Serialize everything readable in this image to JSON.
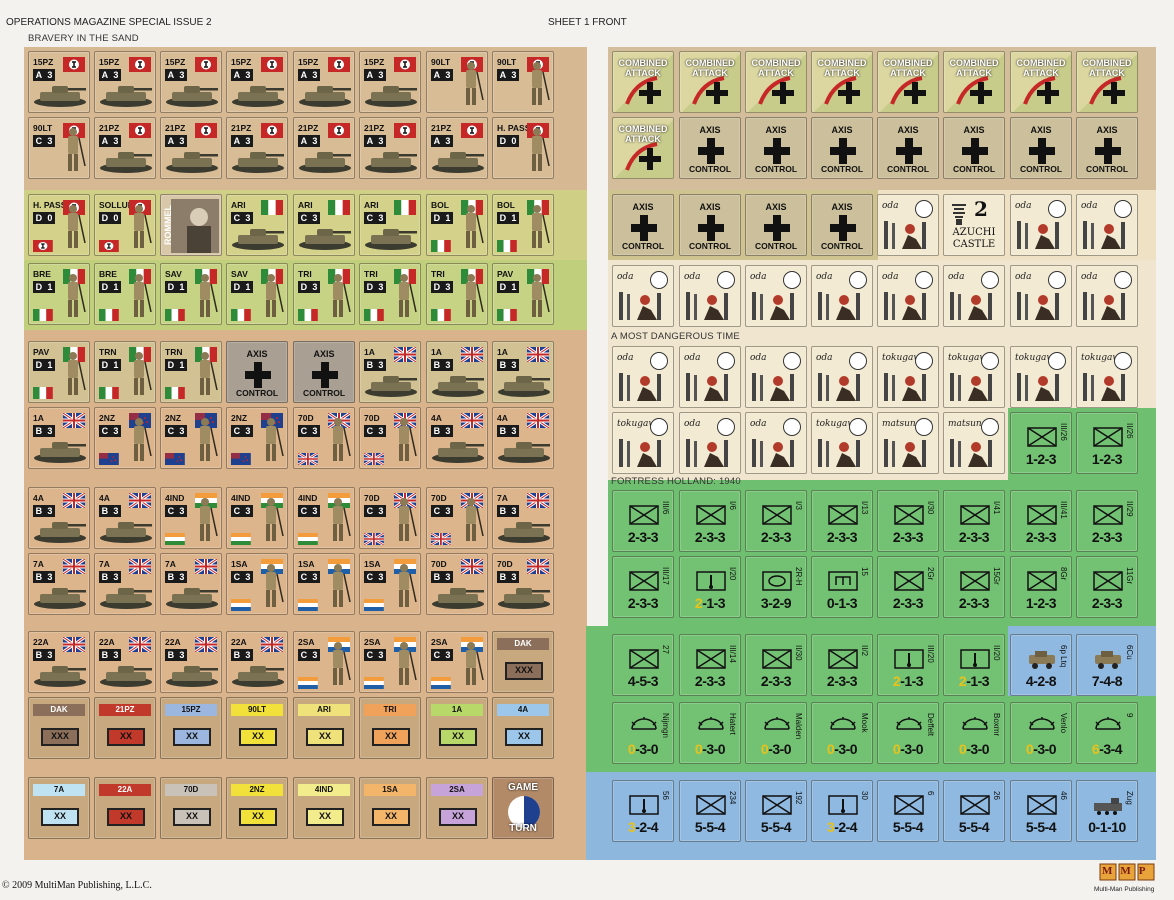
{
  "header": {
    "magazine": "OPERATIONS MAGAZINE SPECIAL ISSUE 2",
    "sheet": "SHEET 1 FRONT"
  },
  "sections": {
    "bravery": "BRAVERY IN THE SAND",
    "dangerous": "A MOST DANGEROUS TIME",
    "holland": "FORTRESS HOLLAND: 1940"
  },
  "footer": {
    "copyright": "© 2009 MultiMan Publishing, L.L.C.",
    "publisher": "Multi-Man Publishing",
    "logo": "MMP"
  },
  "colors": {
    "desert_tan": "#d8b48f",
    "olive_green": "#c8cc7e",
    "light_green": "#b9cb7a",
    "holland_green": "#6fbf70",
    "holland_blue": "#8db7dc",
    "cream": "#efe2c4"
  },
  "left_counters": [
    [
      [
        "15PZ",
        "A",
        "3",
        "ger",
        "tank"
      ],
      [
        "15PZ",
        "A",
        "3",
        "ger",
        "tank"
      ],
      [
        "15PZ",
        "A",
        "3",
        "ger",
        "tank"
      ],
      [
        "15PZ",
        "A",
        "3",
        "ger",
        "tank"
      ],
      [
        "15PZ",
        "A",
        "3",
        "ger",
        "tank"
      ],
      [
        "15PZ",
        "A",
        "3",
        "ger",
        "tank"
      ],
      [
        "90LT",
        "A",
        "3",
        "ger",
        "inf"
      ],
      [
        "90LT",
        "A",
        "3",
        "ger",
        "inf"
      ]
    ],
    [
      [
        "90LT",
        "C",
        "3",
        "ger",
        "inf"
      ],
      [
        "21PZ",
        "A",
        "3",
        "ger",
        "tank"
      ],
      [
        "21PZ",
        "A",
        "3",
        "ger",
        "tank"
      ],
      [
        "21PZ",
        "A",
        "3",
        "ger",
        "tank"
      ],
      [
        "21PZ",
        "A",
        "3",
        "ger",
        "tank"
      ],
      [
        "21PZ",
        "A",
        "3",
        "ger",
        "tank"
      ],
      [
        "21PZ",
        "A",
        "3",
        "ger",
        "tank"
      ],
      [
        "H. PASS",
        "D",
        "0",
        "ger",
        "inf"
      ]
    ],
    [
      [
        "H. PASS",
        "D",
        "0",
        "ger",
        "inf"
      ],
      [
        "SOLLUM",
        "D",
        "0",
        "ger",
        "inf"
      ],
      [
        "ROMMEL",
        "",
        "",
        "",
        "rommel"
      ],
      [
        "ARI",
        "C",
        "3",
        "ita",
        "tank"
      ],
      [
        "ARI",
        "C",
        "3",
        "ita",
        "tank"
      ],
      [
        "ARI",
        "C",
        "3",
        "ita",
        "tank"
      ],
      [
        "BOL",
        "D",
        "1",
        "ita",
        "inf"
      ],
      [
        "BOL",
        "D",
        "1",
        "ita",
        "inf"
      ]
    ],
    [
      [
        "BRE",
        "D",
        "1",
        "ita",
        "inf"
      ],
      [
        "BRE",
        "D",
        "1",
        "ita",
        "inf"
      ],
      [
        "SAV",
        "D",
        "1",
        "ita",
        "inf"
      ],
      [
        "SAV",
        "D",
        "1",
        "ita",
        "inf"
      ],
      [
        "TRI",
        "D",
        "3",
        "ita",
        "inf"
      ],
      [
        "TRI",
        "D",
        "3",
        "ita",
        "inf"
      ],
      [
        "TRI",
        "D",
        "3",
        "ita",
        "inf"
      ],
      [
        "PAV",
        "D",
        "1",
        "ita",
        "inf"
      ]
    ],
    [
      [
        "PAV",
        "D",
        "1",
        "ita",
        "inf"
      ],
      [
        "TRN",
        "D",
        "1",
        "ita",
        "inf"
      ],
      [
        "TRN",
        "D",
        "1",
        "ita",
        "inf"
      ],
      [
        "AXIS",
        "CONTROL",
        "",
        "",
        "axis"
      ],
      [
        "AXIS",
        "CONTROL",
        "",
        "",
        "axis"
      ],
      [
        "1A",
        "B",
        "3",
        "uk",
        "tank"
      ],
      [
        "1A",
        "B",
        "3",
        "uk",
        "tank"
      ],
      [
        "1A",
        "B",
        "3",
        "uk",
        "tank"
      ]
    ],
    [
      [
        "1A",
        "B",
        "3",
        "uk",
        "tank"
      ],
      [
        "2NZ",
        "C",
        "3",
        "nz",
        "inf"
      ],
      [
        "2NZ",
        "C",
        "3",
        "nz",
        "inf"
      ],
      [
        "2NZ",
        "C",
        "3",
        "nz",
        "inf"
      ],
      [
        "70D",
        "C",
        "3",
        "uk",
        "inf"
      ],
      [
        "70D",
        "C",
        "3",
        "uk",
        "inf"
      ],
      [
        "4A",
        "B",
        "3",
        "uk",
        "tank"
      ],
      [
        "4A",
        "B",
        "3",
        "uk",
        "tank"
      ]
    ],
    [
      [
        "4A",
        "B",
        "3",
        "uk",
        "tank"
      ],
      [
        "4A",
        "B",
        "3",
        "uk",
        "tank"
      ],
      [
        "4IND",
        "C",
        "3",
        "ind",
        "inf"
      ],
      [
        "4IND",
        "C",
        "3",
        "ind",
        "inf"
      ],
      [
        "4IND",
        "C",
        "3",
        "ind",
        "inf"
      ],
      [
        "70D",
        "C",
        "3",
        "uk",
        "inf"
      ],
      [
        "70D",
        "C",
        "3",
        "uk",
        "inf"
      ],
      [
        "7A",
        "B",
        "3",
        "uk",
        "tank"
      ]
    ],
    [
      [
        "7A",
        "B",
        "3",
        "uk",
        "tank"
      ],
      [
        "7A",
        "B",
        "3",
        "uk",
        "tank"
      ],
      [
        "7A",
        "B",
        "3",
        "uk",
        "tank"
      ],
      [
        "1SA",
        "C",
        "3",
        "sa",
        "inf"
      ],
      [
        "1SA",
        "C",
        "3",
        "sa",
        "inf"
      ],
      [
        "1SA",
        "C",
        "3",
        "sa",
        "inf"
      ],
      [
        "70D",
        "B",
        "3",
        "uk",
        "tank"
      ],
      [
        "70D",
        "B",
        "3",
        "uk",
        "tank"
      ]
    ],
    [
      [
        "22A",
        "B",
        "3",
        "uk",
        "tank"
      ],
      [
        "22A",
        "B",
        "3",
        "uk",
        "tank"
      ],
      [
        "22A",
        "B",
        "3",
        "uk",
        "tank"
      ],
      [
        "22A",
        "B",
        "3",
        "uk",
        "tank"
      ],
      [
        "2SA",
        "C",
        "3",
        "sa",
        "inf"
      ],
      [
        "2SA",
        "C",
        "3",
        "sa",
        "inf"
      ],
      [
        "2SA",
        "C",
        "3",
        "sa",
        "inf"
      ],
      [
        "DAK",
        "XXX",
        "",
        "#8b6f5a",
        "mkr"
      ]
    ],
    [
      [
        "DAK",
        "XXX",
        "",
        "#8b6f5a",
        "mkr"
      ],
      [
        "21PZ",
        "XX",
        "",
        "#c0392b",
        "mkr"
      ],
      [
        "15PZ",
        "XX",
        "",
        "#9bb7e0",
        "mkr"
      ],
      [
        "90LT",
        "XX",
        "",
        "#f2e13a",
        "mkr"
      ],
      [
        "ARI",
        "XX",
        "",
        "#f0e27a",
        "mkr"
      ],
      [
        "TRI",
        "XX",
        "",
        "#f0a25a",
        "mkr"
      ],
      [
        "1A",
        "XX",
        "",
        "#b9d86a",
        "mkr"
      ],
      [
        "4A",
        "XX",
        "",
        "#9cc7ea",
        "mkr"
      ]
    ],
    [
      [
        "7A",
        "XX",
        "",
        "#bfe3f2",
        "mkr"
      ],
      [
        "22A",
        "XX",
        "",
        "#c0392b",
        "mkr"
      ],
      [
        "70D",
        "XX",
        "",
        "#c9c2b8",
        "mkr"
      ],
      [
        "2NZ",
        "XX",
        "",
        "#f2e13a",
        "mkr"
      ],
      [
        "4IND",
        "XX",
        "",
        "#f3ec8c",
        "mkr"
      ],
      [
        "1SA",
        "XX",
        "",
        "#f3b56a",
        "mkr"
      ],
      [
        "2SA",
        "XX",
        "",
        "#c6a3d9",
        "mkr"
      ],
      [
        "GAME",
        "TURN",
        "",
        "",
        "game"
      ]
    ]
  ],
  "combined_attack": {
    "line1": "COMBINED",
    "line2": "ATTACK"
  },
  "axis_control": {
    "line1": "AXIS",
    "line2": "CONTROL"
  },
  "azuchi": {
    "number": "2",
    "line1": "AZUCHI",
    "line2": "CASTLE"
  },
  "clans": {
    "oda": "oda",
    "tokugawa": "tokugawa",
    "matsunaga": "matsunaga"
  },
  "jp_rows": [
    [
      "oda",
      "oda",
      "oda",
      "oda",
      "oda",
      "oda",
      "oda",
      "oda"
    ],
    [
      "oda",
      "oda",
      "oda",
      "oda",
      "tokugawa",
      "tokugawa",
      "tokugawa",
      "tokugawa"
    ],
    [
      "tokugawa",
      "oda",
      "oda",
      "tokugawa",
      "matsunaga",
      "matsunaga"
    ]
  ],
  "holland_rows": [
    [
      [
        "III/26",
        "1-2-3",
        "inf"
      ],
      [
        "II/26",
        "1-2-3",
        "inf"
      ]
    ],
    [
      [
        "III/6",
        "2-3-3",
        "inf"
      ],
      [
        "I/6",
        "2-3-3",
        "inf"
      ],
      [
        "I/3",
        "2-3-3",
        "inf"
      ],
      [
        "I/13",
        "2-3-3",
        "inf"
      ],
      [
        "I/30",
        "2-3-3",
        "inf"
      ],
      [
        "I/41",
        "2-3-3",
        "inf"
      ],
      [
        "III/41",
        "2-3-3",
        "inf"
      ],
      [
        "II/29",
        "2-3-3",
        "inf"
      ]
    ],
    [
      [
        "III/17",
        "2-3-3",
        "inf"
      ],
      [
        "I/20",
        "2-1-3",
        "mg"
      ],
      [
        "2R-H",
        "3-2-9",
        "lichte"
      ],
      [
        "15",
        "0-1-3",
        "eng"
      ],
      [
        "2Gr",
        "2-3-3",
        "inf"
      ],
      [
        "15Gr",
        "2-3-3",
        "inf"
      ],
      [
        "8Gr",
        "1-2-3",
        "inf"
      ],
      [
        "11Gr",
        "2-3-3",
        "inf"
      ]
    ],
    [
      [
        "27",
        "4-5-3",
        "inf"
      ],
      [
        "III/14",
        "2-3-3",
        "inf"
      ],
      [
        "II/30",
        "2-3-3",
        "inf"
      ],
      [
        "II/2",
        "2-3-3",
        "inf"
      ],
      [
        "III/20",
        "2-1-3",
        "mg"
      ],
      [
        "II/20",
        "2-1-3",
        "mg"
      ],
      [
        "6p Ltq",
        "4-2-8",
        "armcar"
      ],
      [
        "6Cu",
        "7-4-8",
        "armcar"
      ]
    ],
    [
      [
        "Nijmgn",
        "0-3-0",
        "fort"
      ],
      [
        "Hatert",
        "0-3-0",
        "fort"
      ],
      [
        "Malden",
        "0-3-0",
        "fort"
      ],
      [
        "Mook",
        "0-3-0",
        "fort"
      ],
      [
        "Deffelt",
        "0-3-0",
        "fort"
      ],
      [
        "Boxmr",
        "0-3-0",
        "fort"
      ],
      [
        "Venlo",
        "0-3-0",
        "fort"
      ],
      [
        "9",
        "6-3-4",
        "fort"
      ]
    ],
    [
      [
        "56",
        "3-2-4",
        "mg"
      ],
      [
        "234",
        "5-5-4",
        "inf"
      ],
      [
        "192",
        "5-5-4",
        "inf"
      ],
      [
        "30",
        "3-2-4",
        "mg"
      ],
      [
        "6",
        "5-5-4",
        "inf"
      ],
      [
        "26",
        "5-5-4",
        "inf"
      ],
      [
        "46",
        "5-5-4",
        "inf"
      ],
      [
        "Zug",
        "0-1-10",
        "train"
      ]
    ]
  ]
}
